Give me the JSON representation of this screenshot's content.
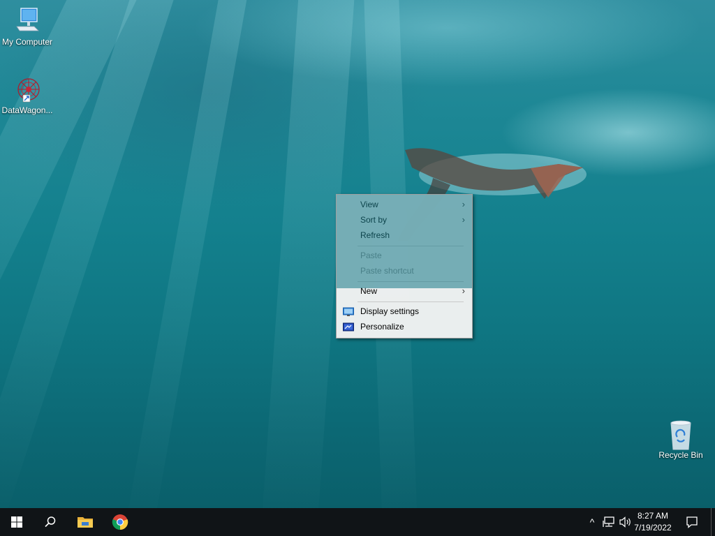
{
  "desktop": {
    "icons": [
      {
        "label": "My Computer",
        "icon": "computer-icon"
      },
      {
        "label": "DataWagon...",
        "icon": "datawagon-shortcut-icon"
      },
      {
        "label": "Recycle Bin",
        "icon": "recycle-bin-icon"
      }
    ]
  },
  "context_menu": {
    "items": [
      {
        "label": "View",
        "has_submenu": true,
        "enabled": true
      },
      {
        "label": "Sort by",
        "has_submenu": true,
        "enabled": true
      },
      {
        "label": "Refresh",
        "has_submenu": false,
        "enabled": true
      },
      {
        "label": "Paste",
        "has_submenu": false,
        "enabled": false
      },
      {
        "label": "Paste shortcut",
        "has_submenu": false,
        "enabled": false
      },
      {
        "label": "New",
        "has_submenu": true,
        "enabled": true
      },
      {
        "label": "Display settings",
        "icon": "display-settings-icon",
        "enabled": true
      },
      {
        "label": "Personalize",
        "icon": "personalize-icon",
        "enabled": true
      }
    ],
    "submenu_arrow": "›"
  },
  "taskbar": {
    "start": "windows-start-icon",
    "search": "search-icon",
    "pinned": [
      {
        "name": "File Explorer",
        "icon": "file-explorer-icon"
      },
      {
        "name": "Google Chrome",
        "icon": "chrome-icon"
      }
    ],
    "tray": {
      "chevron": "^",
      "network": "network-icon",
      "volume": "volume-icon"
    },
    "clock": {
      "time": "8:27 AM",
      "date": "7/19/2022"
    },
    "notifications": "action-center-icon"
  },
  "colors": {
    "taskbar": "#101417",
    "menu_bg": "#f2f2f2",
    "disabled_text": "#8a8a8a"
  }
}
